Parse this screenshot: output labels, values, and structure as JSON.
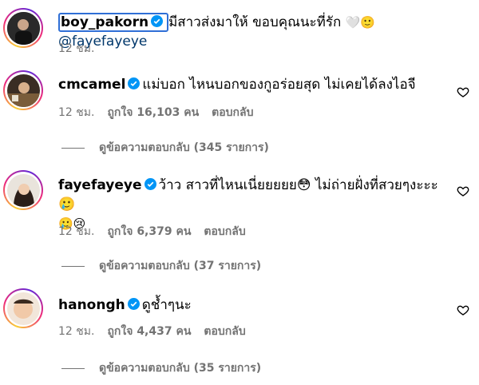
{
  "caption": {
    "username": "boy_pakorn",
    "text": "มีสาวส่งมาให้ ขอบคุณนะที่รัก",
    "emojis": "🤍🙂",
    "mention": "@fayefayeye",
    "time": "12 ชม."
  },
  "comments": [
    {
      "username": "cmcamel",
      "text": "แม่บอก ไหนบอกของกูอร่อยสุด ไม่เคยได้ลงไอจี",
      "time": "12 ชม.",
      "likes": "ถูกใจ 16,103 คน",
      "reply": "ตอบกลับ",
      "view_replies": "ดูข้อความตอบกลับ (345 รายการ)"
    },
    {
      "username": "fayefayeye",
      "text": "ว้าว สาวที่ไหนเนี่ยยยยย😳 ไม่ถ่ายฝั่งที่สวยๆงะะะ 🥲",
      "text2": "🥲😢",
      "time": "12 ชม.",
      "likes": "ถูกใจ 6,379 คน",
      "reply": "ตอบกลับ",
      "view_replies": "ดูข้อความตอบกลับ (37 รายการ)"
    },
    {
      "username": "hanongh",
      "text": "ดูช้ำๆนะ",
      "time": "12 ชม.",
      "likes": "ถูกใจ 4,437 คน",
      "reply": "ตอบกลับ",
      "view_replies": "ดูข้อความตอบกลับ (35 รายการ)"
    }
  ],
  "colors": {
    "verified": "#0095f6",
    "meta": "#737373",
    "mention": "#00376b",
    "highlight": "#2f6fd6"
  },
  "icons": [
    "verified-badge-icon",
    "heart-icon"
  ]
}
